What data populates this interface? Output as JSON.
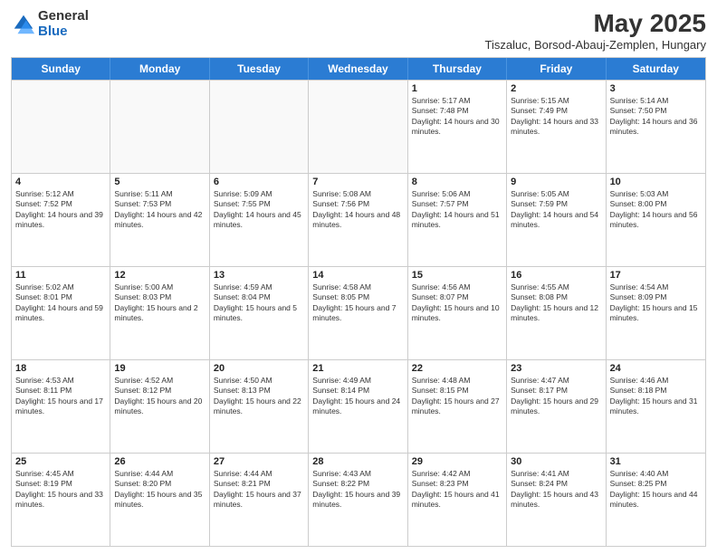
{
  "logo": {
    "general": "General",
    "blue": "Blue"
  },
  "title": "May 2025",
  "subtitle": "Tiszaluc, Borsod-Abauj-Zemplen, Hungary",
  "headers": [
    "Sunday",
    "Monday",
    "Tuesday",
    "Wednesday",
    "Thursday",
    "Friday",
    "Saturday"
  ],
  "rows": [
    [
      {
        "day": "",
        "text": ""
      },
      {
        "day": "",
        "text": ""
      },
      {
        "day": "",
        "text": ""
      },
      {
        "day": "",
        "text": ""
      },
      {
        "day": "1",
        "text": "Sunrise: 5:17 AM\nSunset: 7:48 PM\nDaylight: 14 hours and 30 minutes."
      },
      {
        "day": "2",
        "text": "Sunrise: 5:15 AM\nSunset: 7:49 PM\nDaylight: 14 hours and 33 minutes."
      },
      {
        "day": "3",
        "text": "Sunrise: 5:14 AM\nSunset: 7:50 PM\nDaylight: 14 hours and 36 minutes."
      }
    ],
    [
      {
        "day": "4",
        "text": "Sunrise: 5:12 AM\nSunset: 7:52 PM\nDaylight: 14 hours and 39 minutes."
      },
      {
        "day": "5",
        "text": "Sunrise: 5:11 AM\nSunset: 7:53 PM\nDaylight: 14 hours and 42 minutes."
      },
      {
        "day": "6",
        "text": "Sunrise: 5:09 AM\nSunset: 7:55 PM\nDaylight: 14 hours and 45 minutes."
      },
      {
        "day": "7",
        "text": "Sunrise: 5:08 AM\nSunset: 7:56 PM\nDaylight: 14 hours and 48 minutes."
      },
      {
        "day": "8",
        "text": "Sunrise: 5:06 AM\nSunset: 7:57 PM\nDaylight: 14 hours and 51 minutes."
      },
      {
        "day": "9",
        "text": "Sunrise: 5:05 AM\nSunset: 7:59 PM\nDaylight: 14 hours and 54 minutes."
      },
      {
        "day": "10",
        "text": "Sunrise: 5:03 AM\nSunset: 8:00 PM\nDaylight: 14 hours and 56 minutes."
      }
    ],
    [
      {
        "day": "11",
        "text": "Sunrise: 5:02 AM\nSunset: 8:01 PM\nDaylight: 14 hours and 59 minutes."
      },
      {
        "day": "12",
        "text": "Sunrise: 5:00 AM\nSunset: 8:03 PM\nDaylight: 15 hours and 2 minutes."
      },
      {
        "day": "13",
        "text": "Sunrise: 4:59 AM\nSunset: 8:04 PM\nDaylight: 15 hours and 5 minutes."
      },
      {
        "day": "14",
        "text": "Sunrise: 4:58 AM\nSunset: 8:05 PM\nDaylight: 15 hours and 7 minutes."
      },
      {
        "day": "15",
        "text": "Sunrise: 4:56 AM\nSunset: 8:07 PM\nDaylight: 15 hours and 10 minutes."
      },
      {
        "day": "16",
        "text": "Sunrise: 4:55 AM\nSunset: 8:08 PM\nDaylight: 15 hours and 12 minutes."
      },
      {
        "day": "17",
        "text": "Sunrise: 4:54 AM\nSunset: 8:09 PM\nDaylight: 15 hours and 15 minutes."
      }
    ],
    [
      {
        "day": "18",
        "text": "Sunrise: 4:53 AM\nSunset: 8:11 PM\nDaylight: 15 hours and 17 minutes."
      },
      {
        "day": "19",
        "text": "Sunrise: 4:52 AM\nSunset: 8:12 PM\nDaylight: 15 hours and 20 minutes."
      },
      {
        "day": "20",
        "text": "Sunrise: 4:50 AM\nSunset: 8:13 PM\nDaylight: 15 hours and 22 minutes."
      },
      {
        "day": "21",
        "text": "Sunrise: 4:49 AM\nSunset: 8:14 PM\nDaylight: 15 hours and 24 minutes."
      },
      {
        "day": "22",
        "text": "Sunrise: 4:48 AM\nSunset: 8:15 PM\nDaylight: 15 hours and 27 minutes."
      },
      {
        "day": "23",
        "text": "Sunrise: 4:47 AM\nSunset: 8:17 PM\nDaylight: 15 hours and 29 minutes."
      },
      {
        "day": "24",
        "text": "Sunrise: 4:46 AM\nSunset: 8:18 PM\nDaylight: 15 hours and 31 minutes."
      }
    ],
    [
      {
        "day": "25",
        "text": "Sunrise: 4:45 AM\nSunset: 8:19 PM\nDaylight: 15 hours and 33 minutes."
      },
      {
        "day": "26",
        "text": "Sunrise: 4:44 AM\nSunset: 8:20 PM\nDaylight: 15 hours and 35 minutes."
      },
      {
        "day": "27",
        "text": "Sunrise: 4:44 AM\nSunset: 8:21 PM\nDaylight: 15 hours and 37 minutes."
      },
      {
        "day": "28",
        "text": "Sunrise: 4:43 AM\nSunset: 8:22 PM\nDaylight: 15 hours and 39 minutes."
      },
      {
        "day": "29",
        "text": "Sunrise: 4:42 AM\nSunset: 8:23 PM\nDaylight: 15 hours and 41 minutes."
      },
      {
        "day": "30",
        "text": "Sunrise: 4:41 AM\nSunset: 8:24 PM\nDaylight: 15 hours and 43 minutes."
      },
      {
        "day": "31",
        "text": "Sunrise: 4:40 AM\nSunset: 8:25 PM\nDaylight: 15 hours and 44 minutes."
      }
    ]
  ]
}
